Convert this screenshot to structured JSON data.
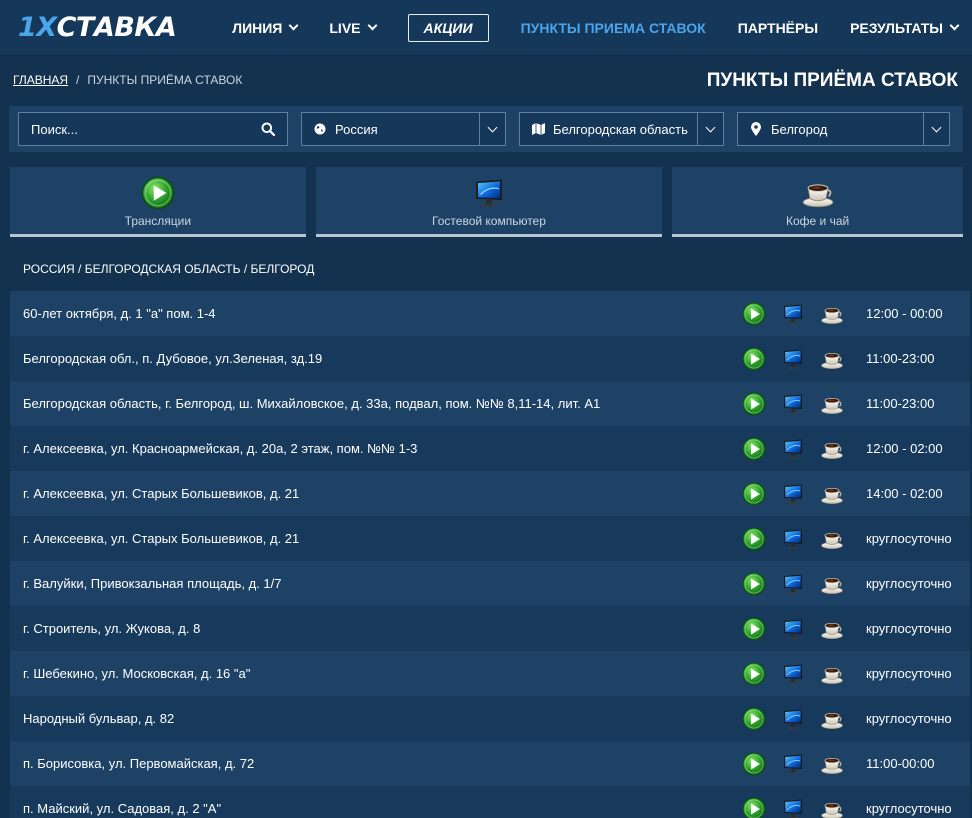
{
  "brand": {
    "part1": "1X",
    "part2": "СТАВКА"
  },
  "nav": {
    "line": "ЛИНИЯ",
    "live": "LIVE",
    "promo": "АКЦИИ",
    "points": "ПУНКТЫ ПРИЕМА СТАВОК",
    "partners": "ПАРТНЁРЫ",
    "results": "РЕЗУЛЬТАТЫ"
  },
  "breadcrumb": {
    "home": "ГЛАВНАЯ",
    "sep": "/",
    "current": "ПУНКТЫ ПРИЁМА СТАВОК"
  },
  "page_title": "ПУНКТЫ ПРИЁМА СТАВОК",
  "filters": {
    "search_placeholder": "Поиск...",
    "country": "Россия",
    "region": "Белгородская область",
    "city": "Белгород"
  },
  "features": {
    "broadcast": "Трансляции",
    "guest_pc": "Гостевой компьютер",
    "coffee": "Кофе и чай"
  },
  "list": {
    "heading": "РОССИЯ / БЕЛГОРОДСКАЯ ОБЛАСТЬ / БЕЛГОРОД",
    "rows": [
      {
        "address": "60-лет октября, д. 1 \"а\" пом. 1-4",
        "hours": "12:00 - 00:00"
      },
      {
        "address": "Белгородская обл., п. Дубовое, ул.Зеленая, зд.19",
        "hours": "11:00-23:00"
      },
      {
        "address": "Белгородская область, г. Белгород, ш. Михайловское, д. 33а, подвал, пом. №№ 8,11-14, лит. А1",
        "hours": "11:00-23:00"
      },
      {
        "address": "г. Алексеевка, ул. Красноармейская, д. 20а, 2 этаж, пом. №№ 1-3",
        "hours": "12:00 - 02:00"
      },
      {
        "address": "г. Алексеевка, ул. Старых Большевиков, д. 21",
        "hours": "14:00 - 02:00"
      },
      {
        "address": "г. Алексеевка, ул. Старых Большевиков, д. 21",
        "hours": "круглосуточно"
      },
      {
        "address": "г. Валуйки, Привокзальная площадь, д. 1/7",
        "hours": "круглосуточно"
      },
      {
        "address": "г. Строитель, ул. Жукова, д. 8",
        "hours": "круглосуточно"
      },
      {
        "address": "г. Шебекино, ул. Московская, д. 16 \"а\"",
        "hours": "круглосуточно"
      },
      {
        "address": "Народный бульвар, д. 82",
        "hours": "круглосуточно"
      },
      {
        "address": "п. Борисовка, ул. Первомайская, д. 72",
        "hours": "11:00-00:00"
      },
      {
        "address": "п. Майский, ул. Садовая, д. 2 \"А\"",
        "hours": "круглосуточно"
      }
    ]
  },
  "icons": {
    "broadcast": "play-icon",
    "guest_pc": "monitor-icon",
    "coffee": "coffee-cup-icon",
    "search": "search-icon",
    "globe": "globe-icon",
    "map": "map-icon",
    "pin": "location-pin-icon"
  },
  "colors": {
    "background": "#13324f",
    "header": "#15375a",
    "accent": "#4ca5ea",
    "row_odd": "#1d4266",
    "row_even": "#173a5c"
  }
}
